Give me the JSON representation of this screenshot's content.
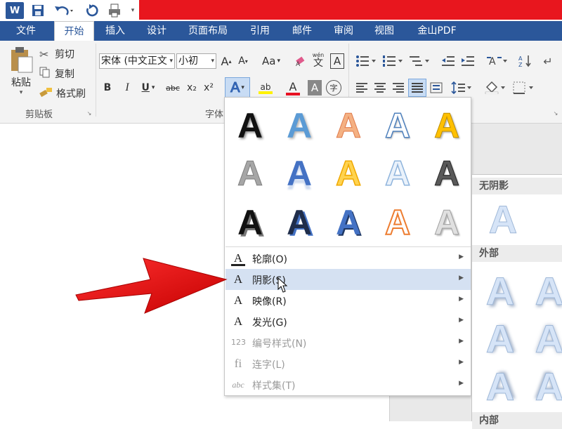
{
  "quick_access": {
    "logo": "W",
    "save_icon": "save-icon",
    "undo_icon": "undo-icon",
    "redo_icon": "redo-icon",
    "print_icon": "print-preview-icon"
  },
  "tabs": [
    {
      "label": "文件"
    },
    {
      "label": "开始"
    },
    {
      "label": "插入"
    },
    {
      "label": "设计"
    },
    {
      "label": "页面布局"
    },
    {
      "label": "引用"
    },
    {
      "label": "邮件"
    },
    {
      "label": "审阅"
    },
    {
      "label": "视图"
    },
    {
      "label": "金山PDF"
    }
  ],
  "clipboard": {
    "paste": "粘贴",
    "cut": "剪切",
    "copy": "复制",
    "format_painter": "格式刷",
    "group_label": "剪贴板"
  },
  "font": {
    "font_name": "宋体 (中文正文",
    "font_size": "小初",
    "grow": "A",
    "shrink": "A",
    "change_case": "Aa",
    "phonetic": "wén",
    "phonetic_char": "文",
    "border_char": "A",
    "bold": "B",
    "italic": "I",
    "underline": "U",
    "strike": "abc",
    "subscript": "x₂",
    "superscript": "x²",
    "text_effects": "A",
    "highlight": "ab",
    "font_color": "A",
    "shading": "A",
    "enclose": "字",
    "group_label": "字体",
    "font_color_hex": "#e81123",
    "highlight_hex": "#fff200"
  },
  "menu": {
    "gallery_letter": "A",
    "items": [
      {
        "icon": "A",
        "label": "轮廓(O)",
        "enabled": true
      },
      {
        "icon": "A",
        "label": "阴影(S)",
        "enabled": true
      },
      {
        "icon": "A",
        "label": "映像(R)",
        "enabled": true
      },
      {
        "icon": "A",
        "label": "发光(G)",
        "enabled": true
      },
      {
        "icon": "123",
        "label": "编号样式(N)",
        "enabled": false
      },
      {
        "icon": "fi",
        "label": "连字(L)",
        "enabled": false
      },
      {
        "icon": "abc",
        "label": "样式集(T)",
        "enabled": false
      }
    ]
  },
  "submenu": {
    "no_shadow": "无阴影",
    "outer": "外部",
    "inner": "内部",
    "letter": "A"
  }
}
